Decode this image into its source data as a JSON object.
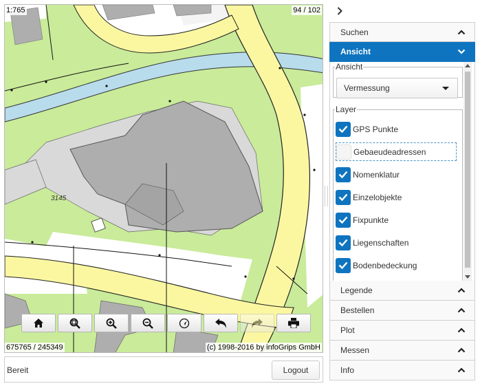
{
  "map": {
    "scale": "1:765",
    "page_indicator": "94 / 102",
    "coordinates": "675765 / 245349",
    "copyright": "(c) 1998-2016 by infoGrips GmbH",
    "parcel_number": "3145",
    "colors": {
      "vegetation": "#c9eb9a",
      "road": "#fbf7a1",
      "building": "#aeaeae",
      "paved": "#d9d9d9",
      "water": "#b8dcec"
    }
  },
  "toolbar": {
    "buttons": [
      {
        "name": "home-button",
        "icon": "home-icon",
        "enabled": true
      },
      {
        "name": "zoom-extent-button",
        "icon": "zoom-extent-icon",
        "enabled": true
      },
      {
        "name": "zoom-in-button",
        "icon": "zoom-in-icon",
        "enabled": true
      },
      {
        "name": "zoom-out-button",
        "icon": "zoom-out-icon",
        "enabled": true
      },
      {
        "name": "locate-button",
        "icon": "locate-icon",
        "enabled": true
      },
      {
        "name": "undo-button",
        "icon": "undo-icon",
        "enabled": true
      },
      {
        "name": "redo-button",
        "icon": "redo-icon",
        "enabled": false
      },
      {
        "name": "print-button",
        "icon": "print-icon",
        "enabled": true
      }
    ]
  },
  "status": {
    "text": "Bereit",
    "logout_label": "Logout"
  },
  "panel": {
    "accent": "#0f74bf",
    "sections": {
      "suchen": "Suchen",
      "ansicht": "Ansicht",
      "legende": "Legende",
      "bestellen": "Bestellen",
      "plot": "Plot",
      "messen": "Messen",
      "info": "Info"
    },
    "view_group_label": "Ansicht",
    "view_selected": "Vermessung",
    "layer_group_label": "Layer",
    "layers": [
      {
        "label": "GPS Punkte",
        "checked": true
      },
      {
        "label": "Gebaeudeadressen",
        "checked": false
      },
      {
        "label": "Nomenklatur",
        "checked": true
      },
      {
        "label": "Einzelobjekte",
        "checked": true
      },
      {
        "label": "Fixpunkte",
        "checked": true
      },
      {
        "label": "Liegenschaften",
        "checked": true
      },
      {
        "label": "Bodenbedeckung",
        "checked": true
      }
    ]
  }
}
